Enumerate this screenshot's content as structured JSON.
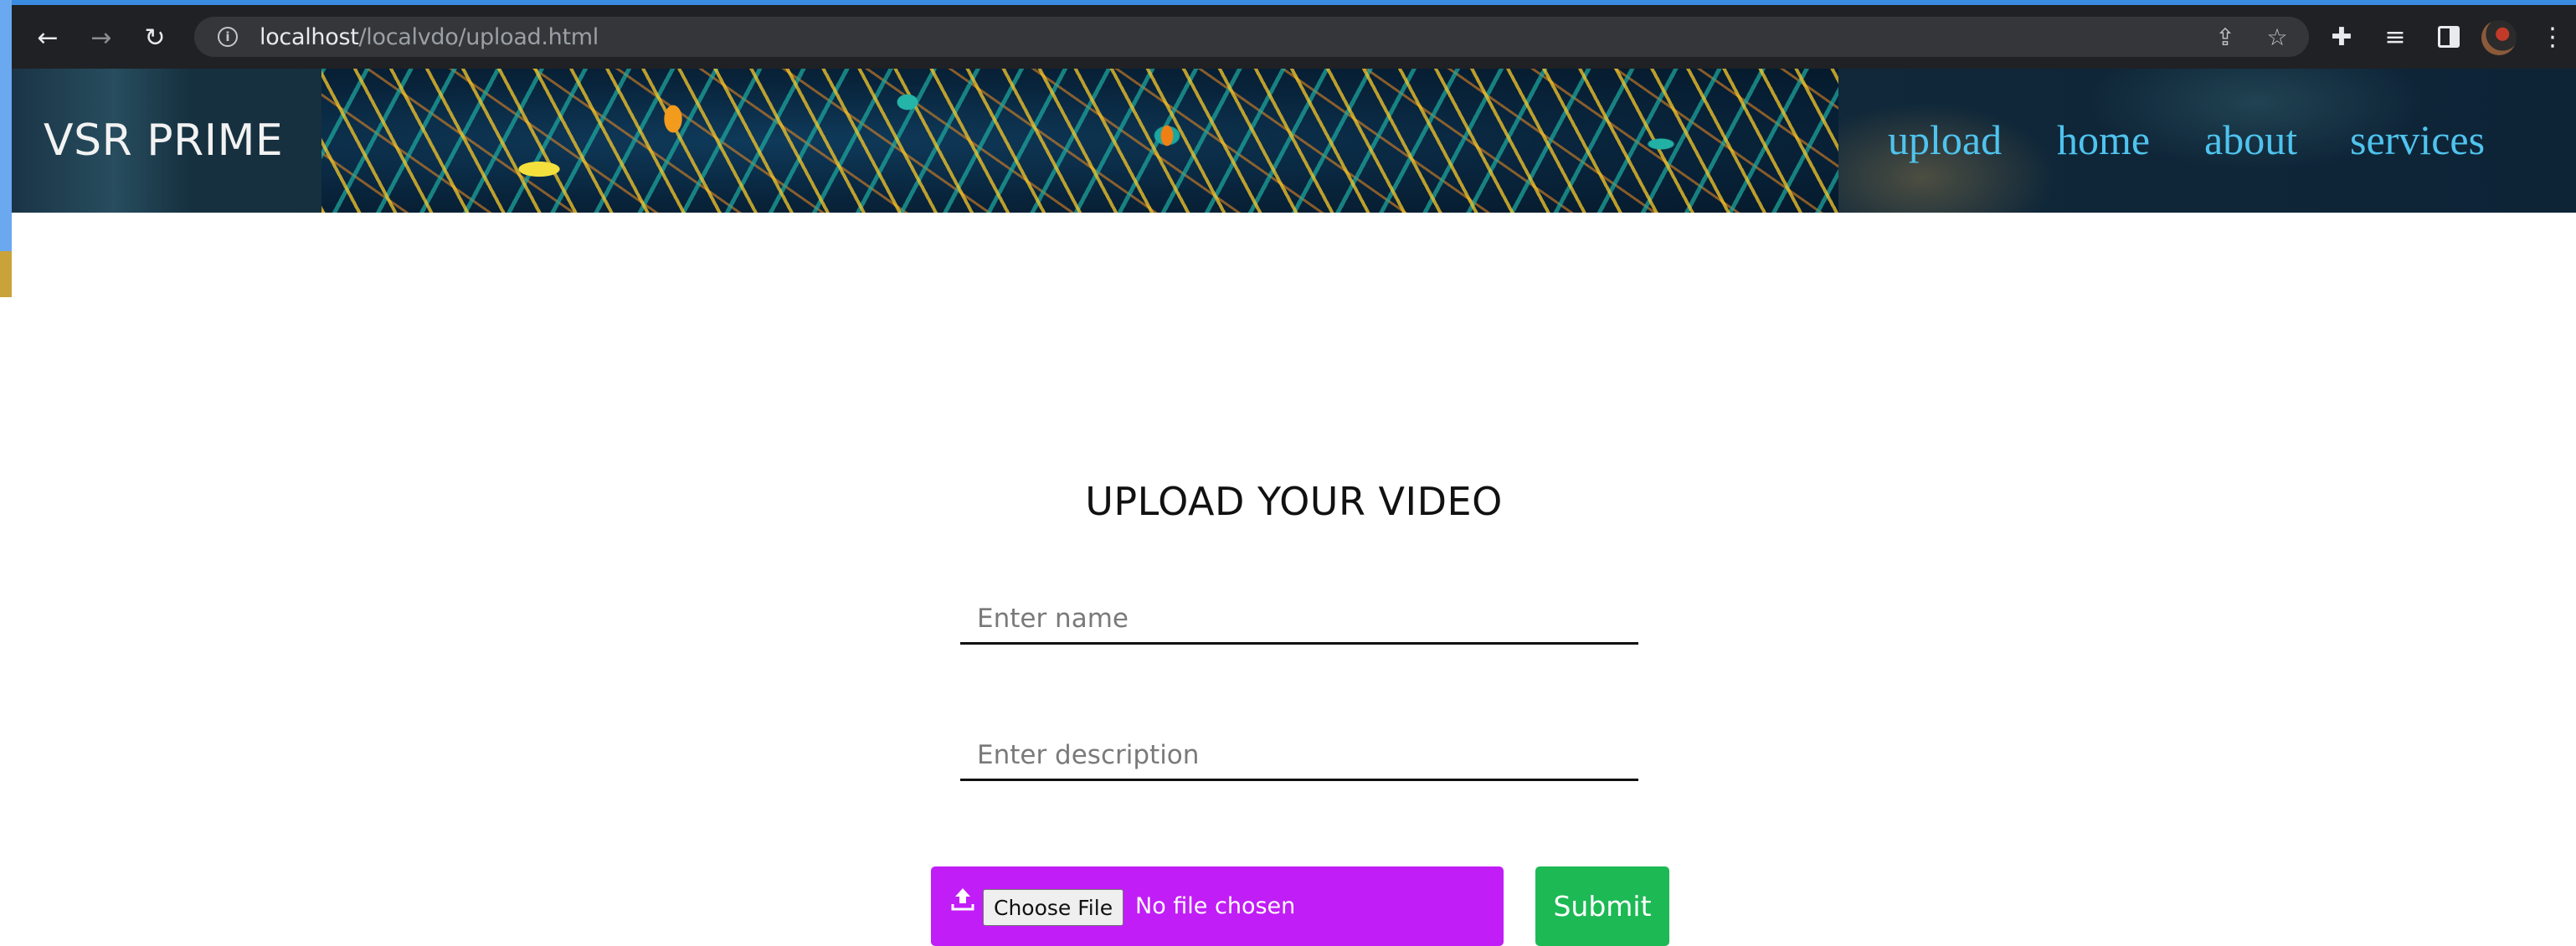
{
  "browser": {
    "url_host": "localhost",
    "url_path": "/localvdo/upload.html"
  },
  "site": {
    "brand": "VSR PRIME",
    "nav": [
      "upload",
      "home",
      "about",
      "services"
    ],
    "nav_color": "#4fc3ee"
  },
  "upload_form": {
    "title": "UPLOAD YOUR VIDEO",
    "name_placeholder": "Enter name",
    "description_placeholder": "Enter description",
    "choose_file_label": "Choose File",
    "no_file_text": "No file chosen",
    "submit_label": "Submit",
    "file_box_color": "#c11df6",
    "submit_color": "#1db954"
  },
  "icons": {
    "back": "arrow-left-icon",
    "forward": "arrow-right-icon",
    "reload": "reload-icon",
    "site_info": "info-icon",
    "share": "share-icon",
    "bookmark": "star-icon",
    "extensions": "puzzle-icon",
    "media": "media-queue-icon",
    "side_panel": "side-panel-icon",
    "profile": "avatar",
    "menu": "kebab-menu-icon",
    "upload": "upload-icon"
  }
}
